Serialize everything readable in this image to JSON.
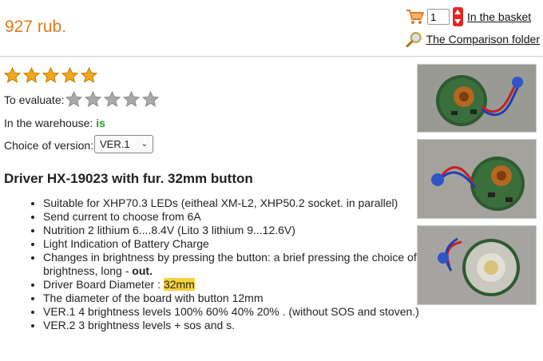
{
  "price": "927 rub.",
  "basket": {
    "quantity": "1",
    "link_label": "In the basket"
  },
  "comparison": {
    "link_label": "The Comparison folder"
  },
  "rating": {
    "stars_filled": 5,
    "stars_total": 5
  },
  "evaluate": {
    "label": "To evaluate:",
    "stars_total": 5
  },
  "warehouse": {
    "label": "In the warehouse:",
    "value": "is"
  },
  "version": {
    "label": "Choice of version:",
    "selected": "VER.1"
  },
  "product_title": "Driver HX-19023 with fur. 32mm button",
  "features": [
    {
      "text": "Suitable for XHP70.3 LEDs (eitheal XM-L2, XHP50.2 socket. in parallel)"
    },
    {
      "text": "Send current to choose from 6A"
    },
    {
      "text": "Nutrition 2 lithium 6....8.4V (Lito 3 lithium 9...12.6V)"
    },
    {
      "text": "Light Indication of Battery Charge"
    },
    {
      "text": "Changes in brightness by pressing the button: a brief pressing the choice of brightness, long - ",
      "bold": "out."
    },
    {
      "text": "Driver Board Diameter : ",
      "highlight": "32mm"
    },
    {
      "text": "The diameter of the board with button 12mm"
    },
    {
      "text": "VER.1 4 brightness levels 100% 60% 40% 20% . (without SOS and stoven.)"
    },
    {
      "text": "VER.2 3 brightness levels + sos and s."
    }
  ],
  "colors": {
    "price": "#e07b1a",
    "star_gold": "#f0a81c",
    "star_gray": "#a9a9a9",
    "in_stock": "#2a9d2a",
    "highlight": "#f7d23a",
    "stepper": "#e52421"
  },
  "icons": {
    "cart": "cart-icon",
    "compare": "magnifier-icon",
    "stepper": "up-down-stepper-icon"
  }
}
